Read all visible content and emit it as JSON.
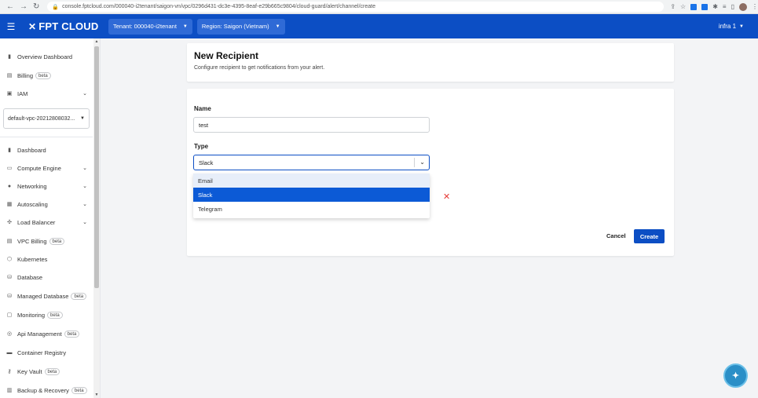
{
  "browser": {
    "url": "console.fptcloud.com/000040-i2tenant/saigon-vn/vpc/0296d431-dc3e-4395-8eaf-e29b665c9804/cloud-guard/alert/channel/create"
  },
  "header": {
    "logo": "FPT CLOUD",
    "tenant": "Tenant: 000040-i2tenant",
    "region": "Region: Saigon (Vietnam)",
    "user": "infra 1"
  },
  "sidebar": {
    "top_items": [
      {
        "label": "Overview Dashboard",
        "icon": "bar-chart-icon"
      },
      {
        "label": "Billing",
        "badge": "beta",
        "icon": "receipt-icon"
      },
      {
        "label": "IAM",
        "icon": "id-card-icon"
      }
    ],
    "vpc_select": "default-vpc-20212808032...",
    "items": [
      {
        "label": "Dashboard"
      },
      {
        "label": "Compute Engine"
      },
      {
        "label": "Networking"
      },
      {
        "label": "Autoscaling"
      },
      {
        "label": "Load Balancer"
      },
      {
        "label": "VPC Billing",
        "badge": "beta"
      },
      {
        "label": "Kubernetes"
      },
      {
        "label": "Database"
      },
      {
        "label": "Managed Database",
        "badge": "beta"
      },
      {
        "label": "Monitoring",
        "badge": "beta"
      },
      {
        "label": "Api Management",
        "badge": "beta"
      },
      {
        "label": "Container Registry"
      },
      {
        "label": "Key Vault",
        "badge": "beta"
      },
      {
        "label": "Backup & Recovery",
        "badge": "beta"
      }
    ]
  },
  "page": {
    "title": "New Recipient",
    "subtitle": "Configure recipient to get notifications from your alert."
  },
  "form": {
    "name_label": "Name",
    "name_value": "test",
    "type_label": "Type",
    "type_value": "Slack",
    "options": [
      "Email",
      "Slack",
      "Telegram"
    ]
  },
  "actions": {
    "cancel": "Cancel",
    "create": "Create"
  },
  "colors": {
    "brand": "#0c4ec4",
    "selected_option": "#0c5ad6",
    "error": "#e53935"
  }
}
